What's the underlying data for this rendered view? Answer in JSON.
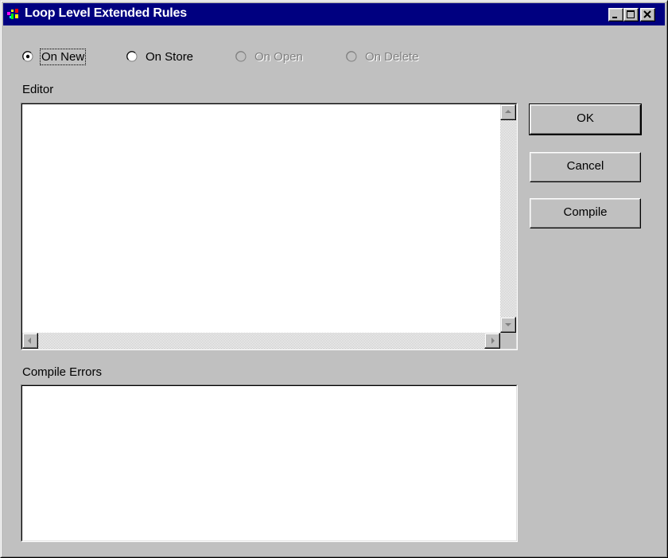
{
  "window": {
    "title": "Loop Level Extended Rules",
    "controls": {
      "minimize": "minimize-icon",
      "maximize": "maximize-icon",
      "close": "close-icon"
    }
  },
  "events": [
    {
      "label": "On New",
      "checked": true,
      "enabled": true
    },
    {
      "label": "On Store",
      "checked": false,
      "enabled": true
    },
    {
      "label": "On Open",
      "checked": false,
      "enabled": false
    },
    {
      "label": "On Delete",
      "checked": false,
      "enabled": false
    }
  ],
  "editor": {
    "label": "Editor",
    "value": ""
  },
  "compile_errors": {
    "label": "Compile Errors",
    "value": ""
  },
  "buttons": {
    "ok": "OK",
    "cancel": "Cancel",
    "compile": "Compile"
  },
  "colors": {
    "titlebar": "#000080",
    "face": "#c0c0c0",
    "field": "#ffffff",
    "disabled_text": "#808080"
  }
}
